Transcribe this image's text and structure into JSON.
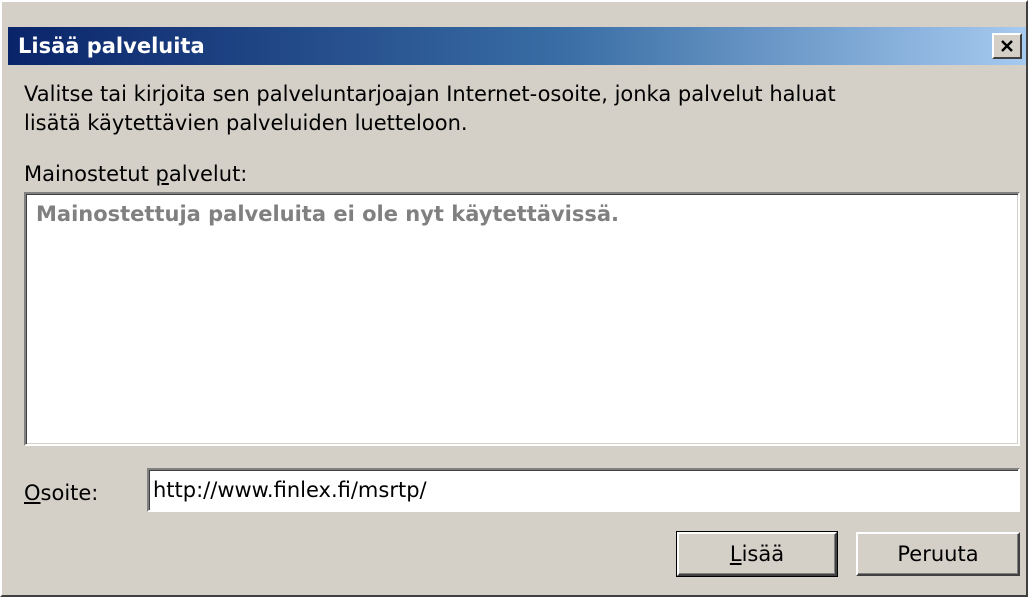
{
  "dialog": {
    "title": "Lisää palveluita",
    "close_icon": "close-x-icon",
    "description_lines": [
      "Valitse tai kirjoita sen palveluntarjoajan Internet-osoite, jonka palvelut haluat",
      "lisätä käytettävien palveluiden luetteloon."
    ],
    "list_label": {
      "before": "Mainostetut ",
      "mnemonic": "p",
      "after": "alvelut:"
    },
    "list_empty_message": "Mainostettuja palveluita ei ole nyt käytettävissä.",
    "address_label": {
      "mnemonic": "O",
      "after": "soite:"
    },
    "address_value": "http://www.finlex.fi/msrtp/",
    "add_button": {
      "mnemonic": "L",
      "after": "isää"
    },
    "cancel_button_label": "Peruuta"
  },
  "colors": {
    "title_gradient_start": "#0a246a",
    "title_gradient_end": "#a6caf0",
    "face": "#d4d0c8",
    "disabled_text": "#808080"
  }
}
